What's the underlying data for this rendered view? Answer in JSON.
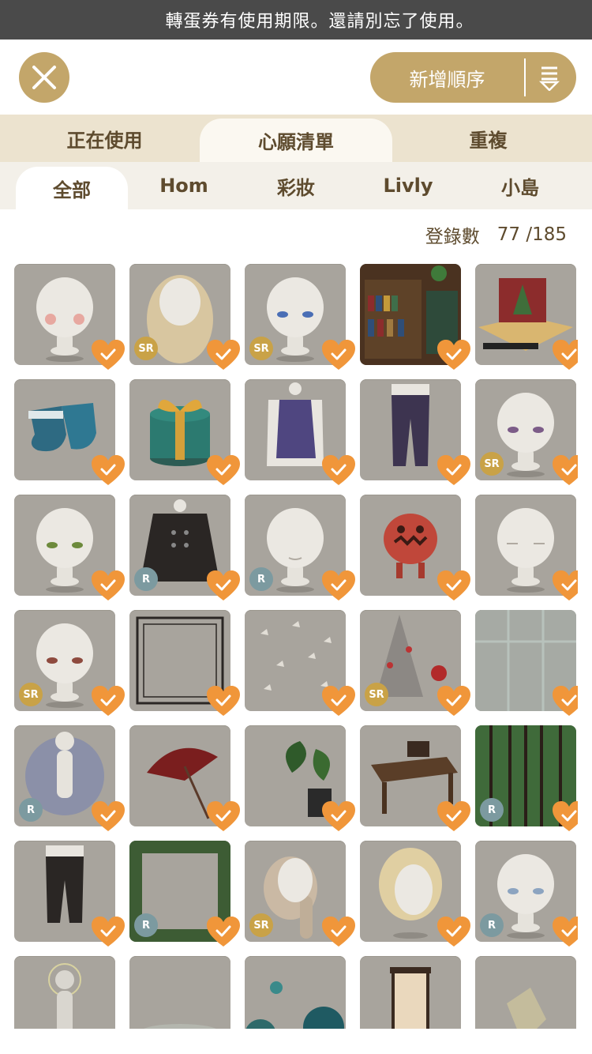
{
  "banner": {
    "text": "轉蛋券有使用期限。還請別忘了使用。"
  },
  "header": {
    "close_icon": "close-icon",
    "sort_label": "新增順序",
    "sort_icon": "sort-descending-icon"
  },
  "tabs": [
    {
      "label": "正在使用",
      "active": false
    },
    {
      "label": "心願清單",
      "active": true
    },
    {
      "label": "重複",
      "active": false
    }
  ],
  "categories": [
    {
      "label": "全部",
      "active": true
    },
    {
      "label": "Hom",
      "active": false
    },
    {
      "label": "彩妝",
      "active": false
    },
    {
      "label": "Livly",
      "active": false
    },
    {
      "label": "小島",
      "active": false
    }
  ],
  "count": {
    "label": "登錄數",
    "value": "77 /185"
  },
  "colors": {
    "accent": "#c3a66a",
    "heart": "#f0963a",
    "tab_bg": "#ece3cf",
    "text": "#5e4b2e"
  },
  "items": [
    {
      "kind": "head-blush",
      "rarity": "",
      "wished": true
    },
    {
      "kind": "hair-wavy",
      "rarity": "SR",
      "wished": true
    },
    {
      "kind": "head-blue-eyes",
      "rarity": "SR",
      "wished": true
    },
    {
      "kind": "bookshelf-room",
      "rarity": "",
      "wished": true
    },
    {
      "kind": "popup-book",
      "rarity": "",
      "wished": true
    },
    {
      "kind": "stockings",
      "rarity": "",
      "wished": true
    },
    {
      "kind": "gift-box",
      "rarity": "",
      "wished": true
    },
    {
      "kind": "vest-coat",
      "rarity": "",
      "wished": true
    },
    {
      "kind": "trousers",
      "rarity": "",
      "wished": true
    },
    {
      "kind": "head-purple-eyes",
      "rarity": "SR",
      "wished": true
    },
    {
      "kind": "head-green-eyes",
      "rarity": "",
      "wished": true
    },
    {
      "kind": "black-cape",
      "rarity": "R",
      "wished": true
    },
    {
      "kind": "head-closed-eyes",
      "rarity": "R",
      "wished": true
    },
    {
      "kind": "pumpkin-creature",
      "rarity": "",
      "wished": true
    },
    {
      "kind": "head-sleepy",
      "rarity": "",
      "wished": true
    },
    {
      "kind": "head-red-eyes",
      "rarity": "SR",
      "wished": true
    },
    {
      "kind": "ornate-frame",
      "rarity": "",
      "wished": true
    },
    {
      "kind": "butterflies",
      "rarity": "",
      "wished": true
    },
    {
      "kind": "silver-tree",
      "rarity": "SR",
      "wished": true
    },
    {
      "kind": "window",
      "rarity": "",
      "wished": true
    },
    {
      "kind": "body-aura",
      "rarity": "R",
      "wished": true
    },
    {
      "kind": "red-umbrella",
      "rarity": "",
      "wished": true
    },
    {
      "kind": "potted-plant",
      "rarity": "",
      "wished": true
    },
    {
      "kind": "wooden-desk",
      "rarity": "",
      "wished": true
    },
    {
      "kind": "iron-gate",
      "rarity": "R",
      "wished": true
    },
    {
      "kind": "black-pants",
      "rarity": "",
      "wished": true
    },
    {
      "kind": "leaf-frame",
      "rarity": "R",
      "wished": true
    },
    {
      "kind": "hair-braid",
      "rarity": "SR",
      "wished": true
    },
    {
      "kind": "hair-blonde-braid",
      "rarity": "",
      "wished": true
    },
    {
      "kind": "head-light-eyes",
      "rarity": "R",
      "wished": true
    },
    {
      "kind": "body-halo",
      "rarity": "",
      "wished": false
    },
    {
      "kind": "mist-floor",
      "rarity": "",
      "wished": false
    },
    {
      "kind": "coral-plants",
      "rarity": "",
      "wished": false
    },
    {
      "kind": "paper-lantern",
      "rarity": "",
      "wished": false
    },
    {
      "kind": "crystal-shard",
      "rarity": "",
      "wished": false
    }
  ]
}
